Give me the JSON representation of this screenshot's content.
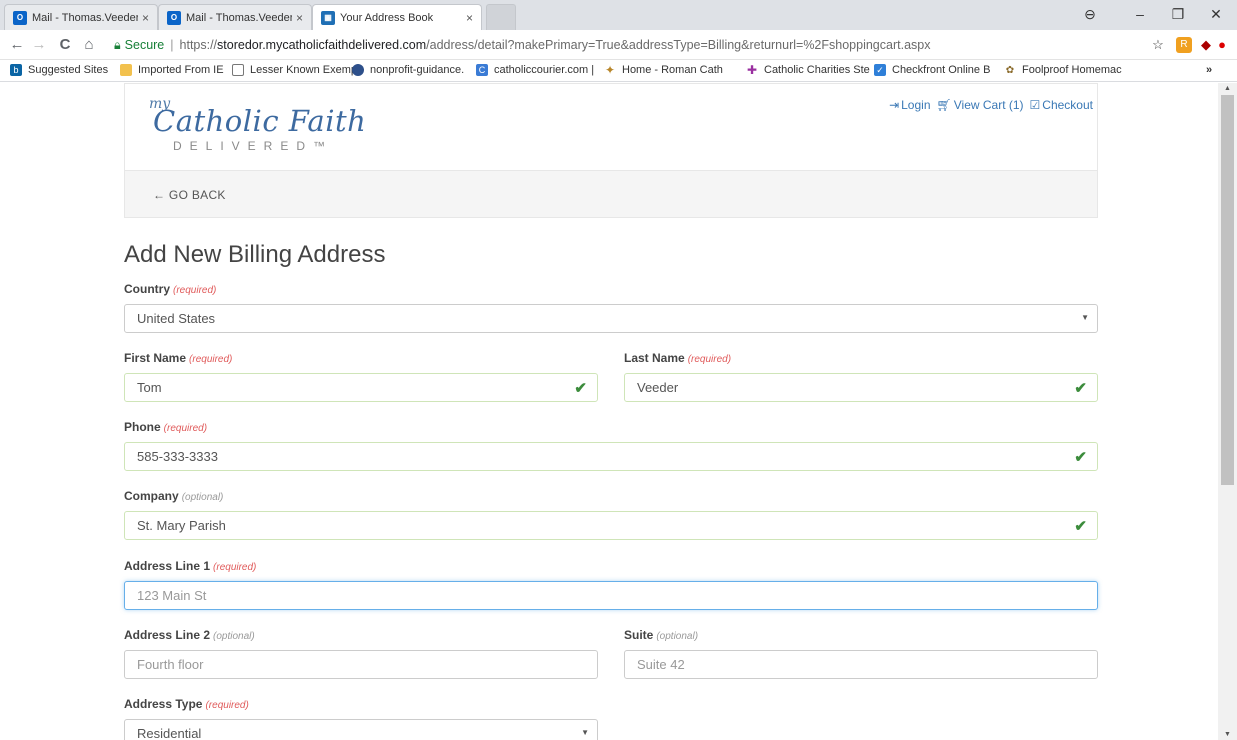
{
  "browser": {
    "tabs": [
      {
        "label": "Mail - Thomas.Veeder@c",
        "close": "×"
      },
      {
        "label": "Mail - Thomas.Veeder@c",
        "close": "×"
      },
      {
        "label": "Your Address Book",
        "close": "×"
      }
    ],
    "window_controls": {
      "profile": "⊖",
      "minimize": "–",
      "restore": "❐",
      "close": "✕"
    },
    "nav": {
      "back": "←",
      "forward": "→",
      "reload": "C",
      "home": "⌂"
    },
    "url": {
      "secure_label": "Secure",
      "scheme": "https://",
      "host": "storedor.mycatholicfaithdelivered.com",
      "path": "/address/detail?makePrimary=True&addressType=Billing&returnurl=%2Fshoppingcart.aspx"
    },
    "bookmarks": [
      "Suggested Sites",
      "Imported From IE",
      "Lesser Known Exemp",
      "nonprofit-guidance.",
      "catholiccourier.com |",
      "Home - Roman Cath",
      "Catholic Charities Ste",
      "Checkfront Online B",
      "Foolproof Homemac"
    ],
    "bookmarks_overflow": "»"
  },
  "site": {
    "logo": {
      "my": "my",
      "main": "Catholic Faith",
      "sub": "DELIVERED™"
    },
    "top_links": {
      "login": "Login",
      "view_cart": "View Cart (1)",
      "checkout": "Checkout"
    },
    "go_back": "← GO BACK"
  },
  "form": {
    "title": "Add New Billing Address",
    "country": {
      "label": "Country",
      "tag": "(required)",
      "value": "United States"
    },
    "first_name": {
      "label": "First Name",
      "tag": "(required)",
      "value": "Tom"
    },
    "last_name": {
      "label": "Last Name",
      "tag": "(required)",
      "value": "Veeder"
    },
    "phone": {
      "label": "Phone",
      "tag": "(required)",
      "value": "585-333-3333"
    },
    "company": {
      "label": "Company",
      "tag": "(optional)",
      "value": "St. Mary Parish"
    },
    "address1": {
      "label": "Address Line 1",
      "tag": "(required)",
      "placeholder": "123 Main St"
    },
    "address2": {
      "label": "Address Line 2",
      "tag": "(optional)",
      "placeholder": "Fourth floor"
    },
    "suite": {
      "label": "Suite",
      "tag": "(optional)",
      "placeholder": "Suite 42"
    },
    "address_type": {
      "label": "Address Type",
      "tag": "(required)",
      "value": "Residential"
    }
  },
  "colors": {
    "link": "#3a78b5",
    "required": "#e05a5a",
    "valid_check": "#3c8c3c",
    "focus_border": "#66afe9"
  }
}
